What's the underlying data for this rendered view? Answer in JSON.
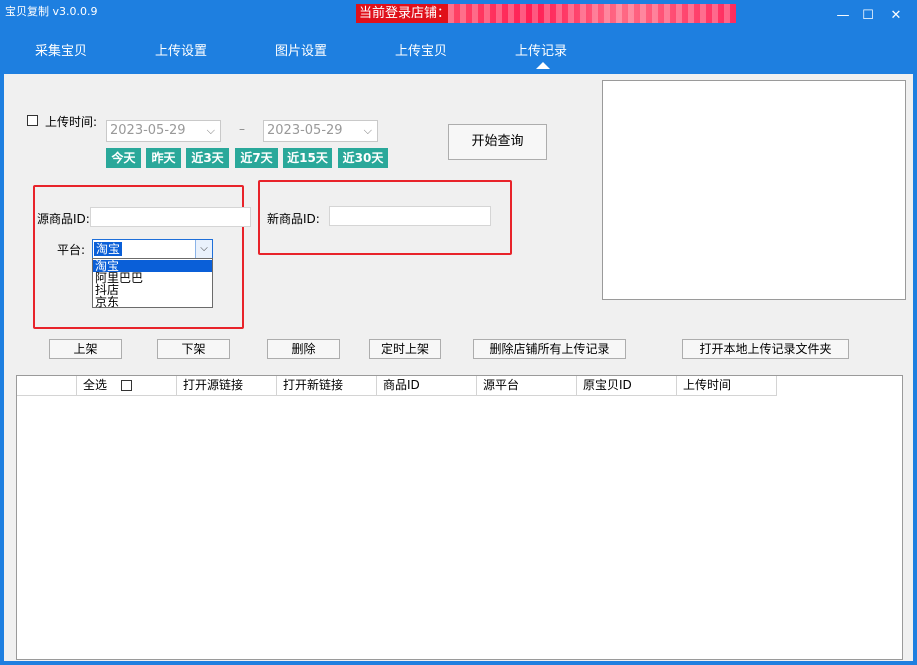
{
  "app": {
    "title": "宝贝复制 v3.0.0.9",
    "store_label": "当前登录店铺："
  },
  "window_controls": {
    "minimize": "—",
    "maximize": "☐",
    "close": "✕"
  },
  "tabs": [
    {
      "label": "采集宝贝"
    },
    {
      "label": "上传设置"
    },
    {
      "label": "图片设置"
    },
    {
      "label": "上传宝贝"
    },
    {
      "label": "上传记录"
    }
  ],
  "filters": {
    "upload_time_label": "上传时间:",
    "date_from": "2023-05-29",
    "date_to": "2023-05-29",
    "date_sep": "–",
    "query_button": "开始查询",
    "quick": [
      "今天",
      "昨天",
      "近3天",
      "近7天",
      "近15天",
      "近30天"
    ]
  },
  "source_id": {
    "label": "源商品ID:",
    "value": ""
  },
  "new_id": {
    "label": "新商品ID:",
    "value": ""
  },
  "platform": {
    "label": "平台:",
    "selected": "淘宝",
    "options": [
      "淘宝",
      "阿里巴巴",
      "抖店",
      "京东"
    ]
  },
  "actions": [
    "上架",
    "下架",
    "删除",
    "定时上架",
    "删除店铺所有上传记录",
    "打开本地上传记录文件夹"
  ],
  "table": {
    "select_all": "全选",
    "columns": [
      "打开源链接",
      "打开新链接",
      "商品ID",
      "源平台",
      "原宝贝ID",
      "上传时间"
    ]
  },
  "colors": {
    "brand": "#1e7fe0",
    "quick_filter": "#2aa89a",
    "highlight": "#e8232a"
  }
}
